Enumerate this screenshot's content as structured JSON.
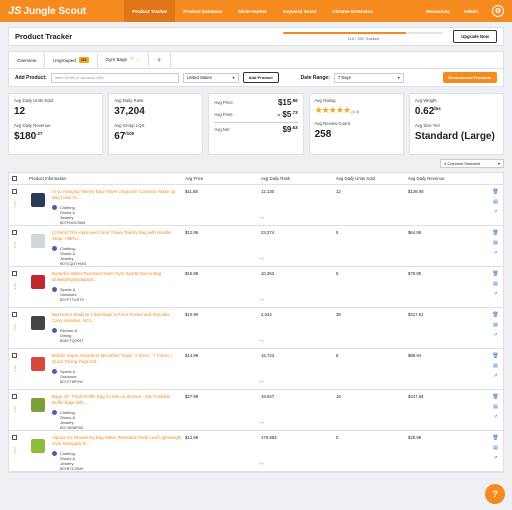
{
  "brand": {
    "mark": "JS",
    "name": "Jungle Scout"
  },
  "nav": [
    "Product Tracker",
    "Product Database",
    "Niche Hunter",
    "Keyword Scout",
    "Chrome Extension"
  ],
  "right_nav": [
    "Resources",
    "Admin"
  ],
  "header": {
    "title": "Product Tracker",
    "tracked": "116 / 150 Tracked",
    "tracked_fraction": 0.77,
    "upgrade": "Upgrade Now"
  },
  "tabs": [
    {
      "label": "Overview"
    },
    {
      "label": "Ungrouped",
      "count": "111"
    },
    {
      "label": "Gym Bags"
    }
  ],
  "controls": {
    "add_label": "Add Product:",
    "asin_placeholder": "Insert ASIN or Amazon URL",
    "marketplace": "United States",
    "add_button": "Add Product",
    "date_label": "Date Range:",
    "date_value": "7 Days",
    "recommend": "Recommend Products"
  },
  "stats": {
    "units_label": "Avg Daily Units Sold",
    "units": "12",
    "revenue_label": "Avg Daily Revenue",
    "revenue_main": "$180",
    "revenue_cents": ".27",
    "rank_label": "Avg Daily Rank",
    "rank": "37,204",
    "group_label": "Avg Group LQS",
    "group": "67",
    "group_sub": "/100",
    "price_label": "Avg Price",
    "price_main": "$15",
    "price_cents": ".96",
    "fees_label": "Avg Fees",
    "fees_main": "- $5",
    "fees_cents": ".73",
    "net_label": "Avg Net",
    "net_main": "$9",
    "net_cents": ".63",
    "rating_label": "Avg Rating",
    "rating": "(4.4)",
    "rating_value": 4.4,
    "reviews_label": "Avg Review Count",
    "reviews": "258",
    "weight_label": "Avg Weight",
    "weight": "0.62",
    "weight_unit": "lbs",
    "size_label": "Avg Size Tier",
    "size": "Standard (Large)"
  },
  "columns_select": "4 Columns Selected",
  "table": {
    "headers": [
      "Product Information",
      "Avg Price",
      "Avg Daily Rank",
      "Avg Daily Units Sold",
      "Avg Daily Revenue"
    ],
    "rows": [
      {
        "title": "Ai-yu Hanging Toiletry Bag-Travel Organizer Cosmetic Make up Bag Case To...",
        "category": "Clothing, Shoes & Jewelry",
        "asin": "B07FNGCS6M",
        "price": "$11.58",
        "rank": "12,130",
        "units": "12",
        "revenue": "$139.08",
        "color": "#2b3a55"
      },
      {
        "title": "[2 Pack] TSA-Approved Clear Travel Toiletry Bag with Handle Strap. AMRU...",
        "category": "Clothing, Shoes & Jewelry",
        "asin": "B07CQDYHW3",
        "price": "$12.95",
        "rank": "23,274",
        "units": "5",
        "revenue": "$64.95",
        "color": "#cfd6dc"
      },
      {
        "title": "Butterfox Water Resistant Swim Gym Sports Dance Bag Drawstring Backpack...",
        "category": "Sports & Outdoors",
        "asin": "B07FYTUSTV",
        "price": "$15.88",
        "rank": "10,363",
        "units": "5",
        "revenue": "$79.85",
        "color": "#c0282d"
      },
      {
        "title": "BeeGreen Stadium Clear Bags w Front Pocket and Shoulder Carry Handles, NCA...",
        "category": "Kitchen & Dining",
        "asin": "B08YTQ2K5T",
        "price": "$10.90",
        "rank": "2,634",
        "units": "38",
        "revenue": "$417.52",
        "color": "#444"
      },
      {
        "title": "Bulbbit Super Absorbent Microfiber Towel, 4 Sizes - 7 Colors | Quick Drying Yoga Gol...",
        "category": "Sports & Outdoors",
        "asin": "B07CT8RYW",
        "price": "$14.99",
        "rank": "15,723",
        "units": "6",
        "revenue": "$89.94",
        "color": "#d9473b"
      },
      {
        "title": "Bago 23\" Travel Duffle Bag for Men & Women - 60L Foldable Duffel Bags with...",
        "category": "Clothing, Shoes & Jewelry",
        "asin": "B07JM38F6D",
        "price": "$27.99",
        "rank": "19,927",
        "units": "16",
        "revenue": "$447.84",
        "color": "#7aa03a"
      },
      {
        "title": "Alpaca Go Drawstring Bag Water Resistant Floral Leaf Lightweight Gym Sackpack fo...",
        "category": "Clothing, Shoes & Jewelry",
        "asin": "B07BTZJ3NH",
        "price": "$12.99",
        "rank": "179,863",
        "units": "0",
        "revenue": "$25.98",
        "color": "#8dbb3a"
      }
    ]
  }
}
